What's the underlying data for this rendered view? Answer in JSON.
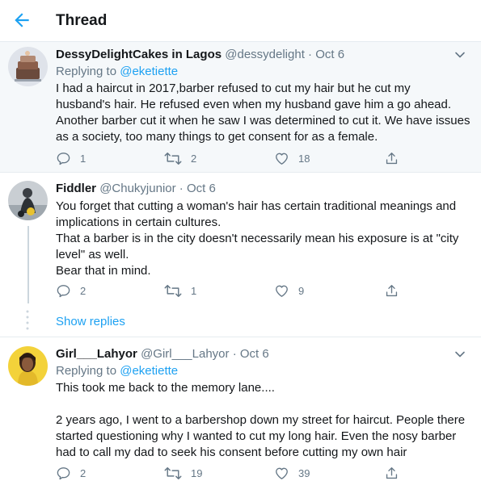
{
  "header": {
    "title": "Thread",
    "accent": "#1da1f2"
  },
  "tweets": [
    {
      "name": "DessyDelightCakes in Lagos",
      "handle": "@dessydelight",
      "dot": "·",
      "date": "Oct 6",
      "replying_prefix": "Replying to ",
      "replying_to": "@eketiette",
      "lines": [
        "I had a haircut in 2017,barber refused to cut my hair but he cut my",
        "husband's hair. He refused even when my husband gave him a go ahead.",
        "Another barber cut it when he saw I was determined to cut it. We have issues",
        "as a society, too many things to get consent for as a female."
      ],
      "replies": "1",
      "retweets": "2",
      "likes": "18"
    },
    {
      "name": "Fiddler",
      "handle": "@Chukyjunior",
      "dot": "·",
      "date": "Oct 6",
      "lines": [
        "You forget that cutting a woman's hair has certain traditional meanings and",
        "implications in certain cultures.",
        "That a barber is in the city doesn't necessarily mean his exposure is at \"city",
        "level\" as well.",
        "Bear that in mind."
      ],
      "replies": "2",
      "retweets": "1",
      "likes": "9"
    },
    {
      "name": "Girl___Lahyor",
      "handle": "@Girl___Lahyor",
      "dot": "·",
      "date": "Oct 6",
      "replying_prefix": "Replying to ",
      "replying_to": "@eketiette",
      "lines": [
        "This took me back to the memory lane....",
        "",
        "2 years ago, I went to a barbershop down my street for haircut. People there",
        "started questioning why I wanted to cut my long hair. Even the nosy barber",
        "had to call my dad to seek his consent before cutting my own hair"
      ],
      "replies": "2",
      "retweets": "19",
      "likes": "39"
    }
  ],
  "show_replies_label": "Show replies"
}
